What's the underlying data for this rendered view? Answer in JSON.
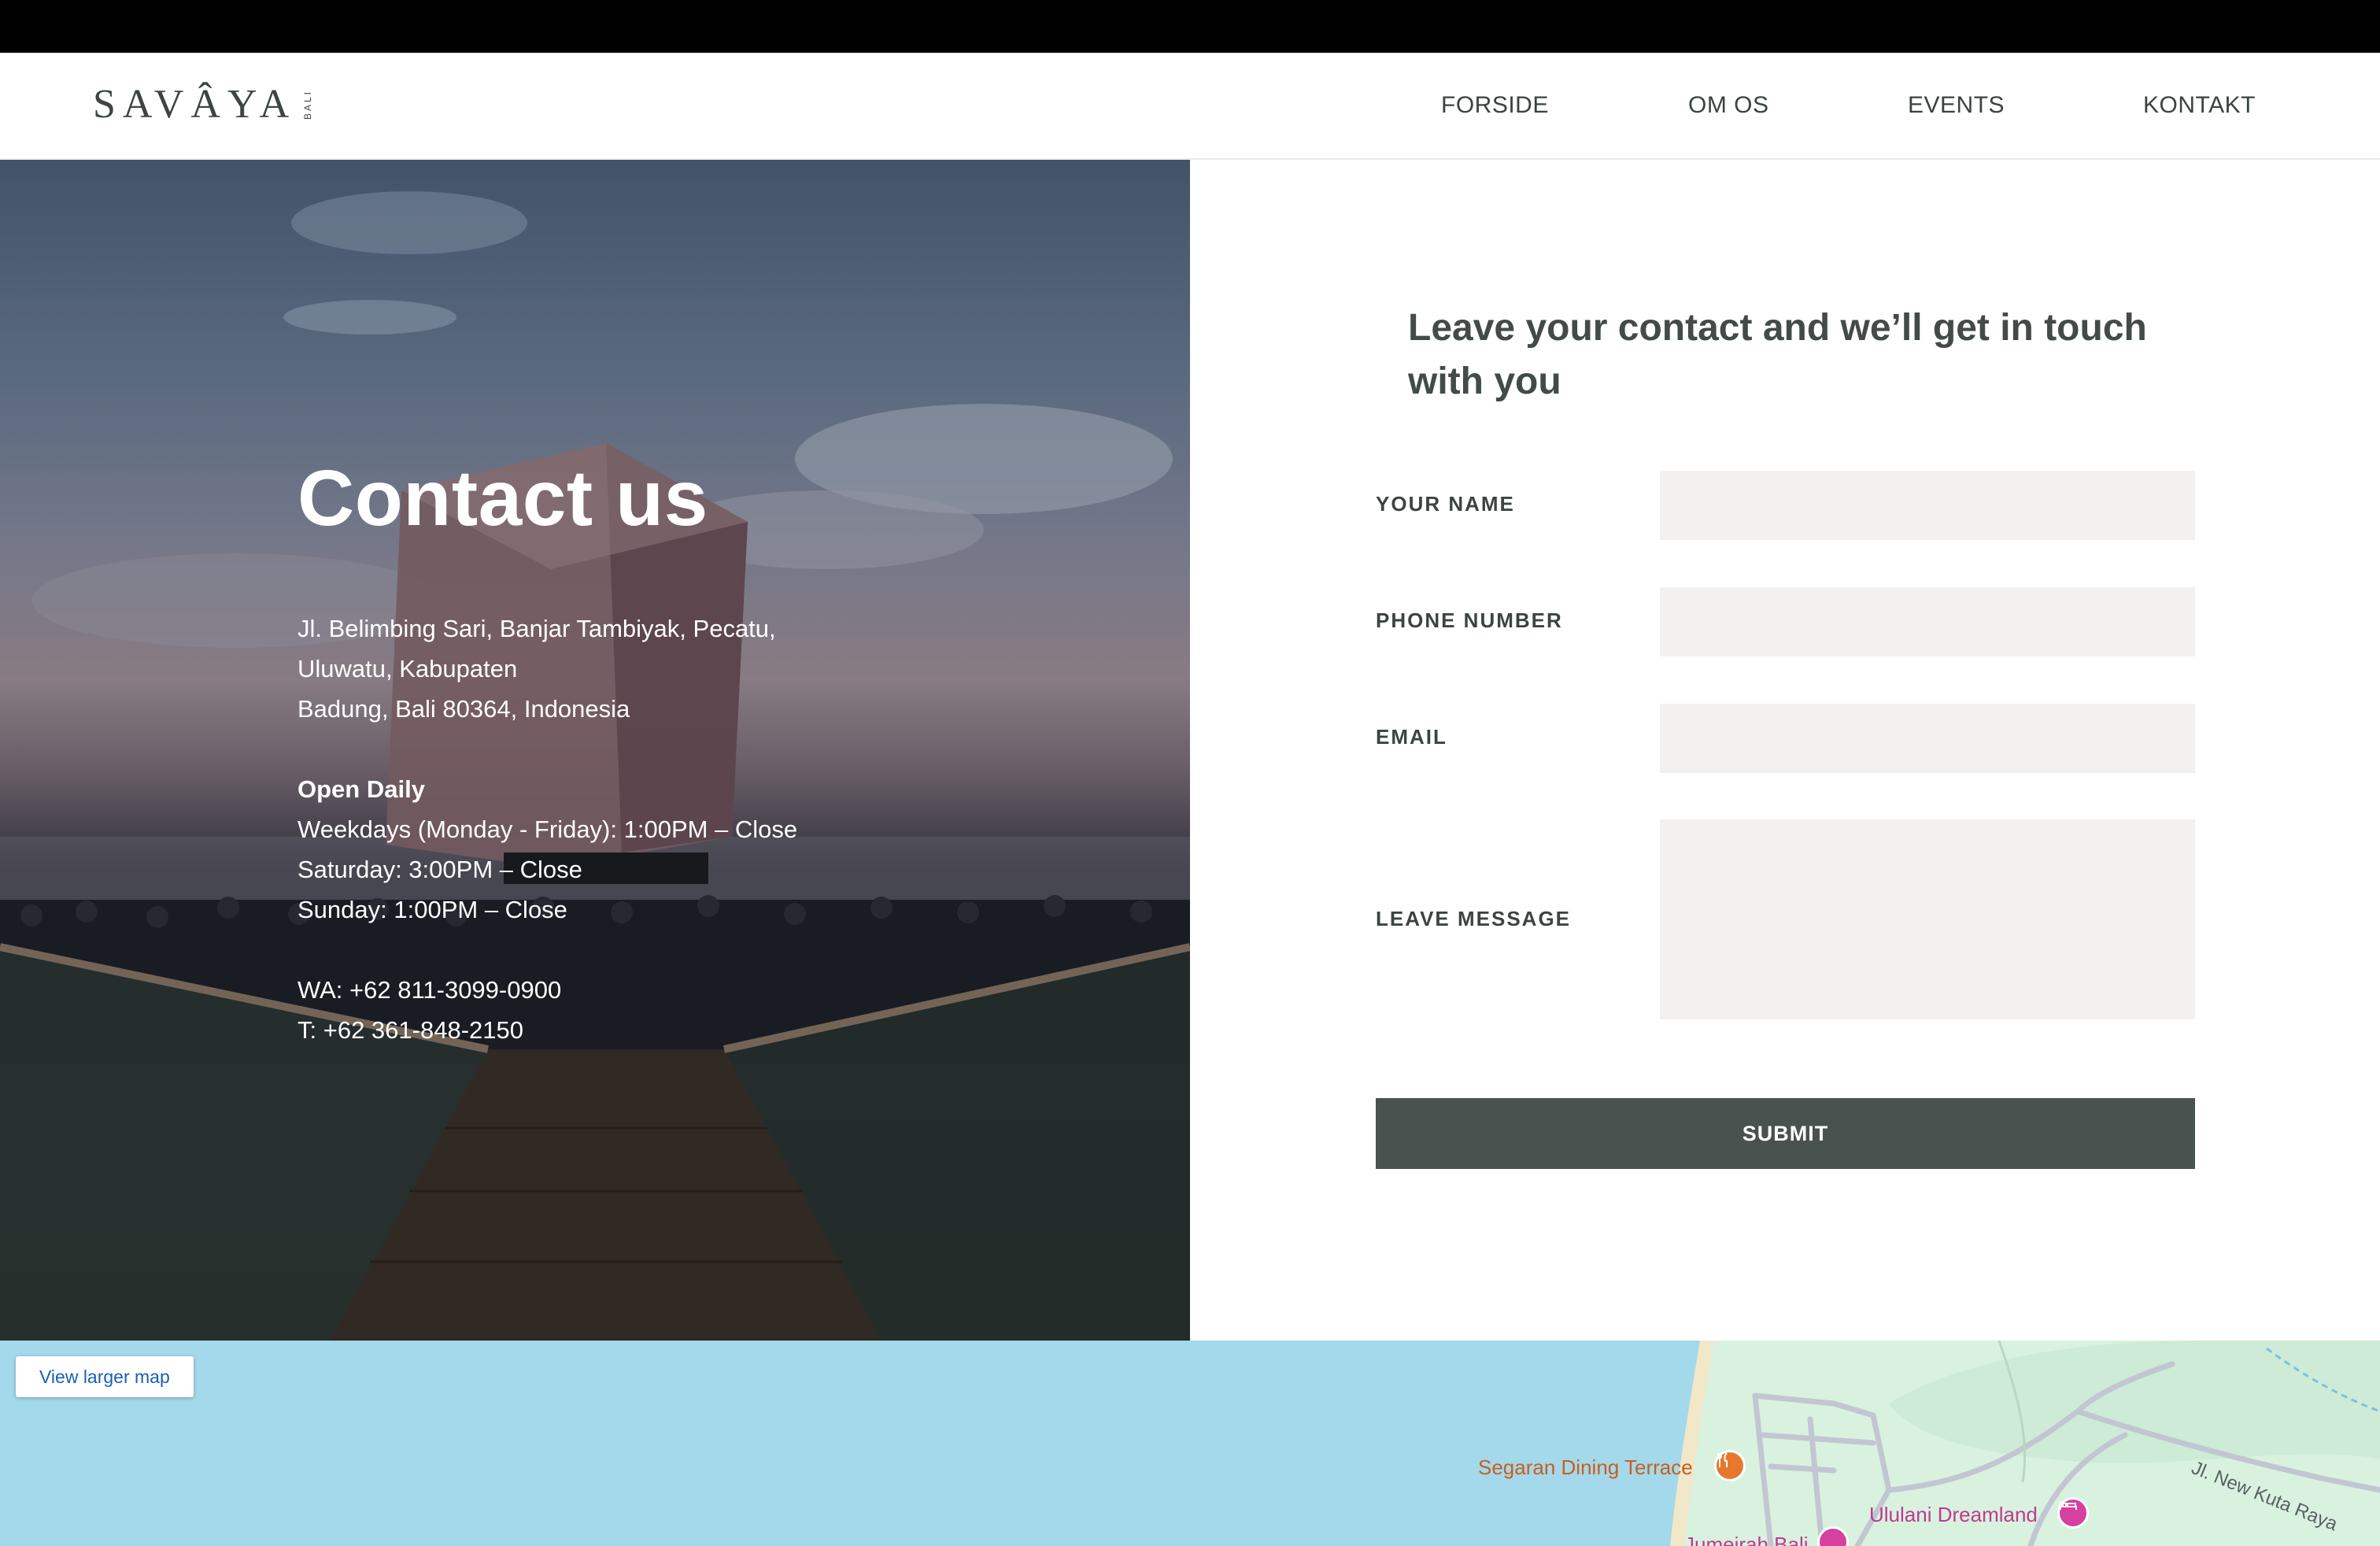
{
  "header": {
    "logo_text": "SAVÂYA",
    "logo_sub": "BALI",
    "nav": [
      "FORSIDE",
      "OM OS",
      "EVENTS",
      "KONTAKT"
    ]
  },
  "hero": {
    "title": "Contact us",
    "address_lines": [
      "Jl. Belimbing Sari, Banjar Tambiyak, Pecatu,",
      "Uluwatu, Kabupaten",
      "Badung, Bali 80364, Indonesia"
    ],
    "hours_title": "Open Daily",
    "hours_lines": [
      "Weekdays (Monday - Friday): 1:00PM – Close",
      "Saturday: 3:00PM – Close",
      "Sunday: 1:00PM – Close"
    ],
    "phone_lines": [
      "WA: +62 811-3099-0900",
      "T: +62 361-848-2150"
    ]
  },
  "form": {
    "heading": "Leave your contact and we’ll get in touch with you",
    "fields": [
      {
        "label": "YOUR NAME",
        "value": ""
      },
      {
        "label": "PHONE NUMBER",
        "value": ""
      },
      {
        "label": "EMAIL",
        "value": ""
      }
    ],
    "message_label": "LEAVE MESSAGE",
    "message_value": "",
    "submit_label": "SUBMIT"
  },
  "map": {
    "view_larger": "View larger map",
    "places": [
      {
        "name": "Segaran Dining Terrace",
        "icon": "restaurant-pin-icon",
        "color": "#e8772e"
      },
      {
        "name": "Ululani Dreamland",
        "icon": "hotel-pin-icon",
        "color": "#d6409f"
      },
      {
        "name": "Jumeirah Bali",
        "icon": "hotel-pin-icon",
        "color": "#d6409f"
      }
    ],
    "road_label": "Jl. New Kuta Raya"
  },
  "colors": {
    "text_dark": "#434b49",
    "input_bg": "#f2f1ef",
    "button_bg": "#4a524f",
    "map_water": "#a3d9ea",
    "map_land": "#d8f2df"
  }
}
